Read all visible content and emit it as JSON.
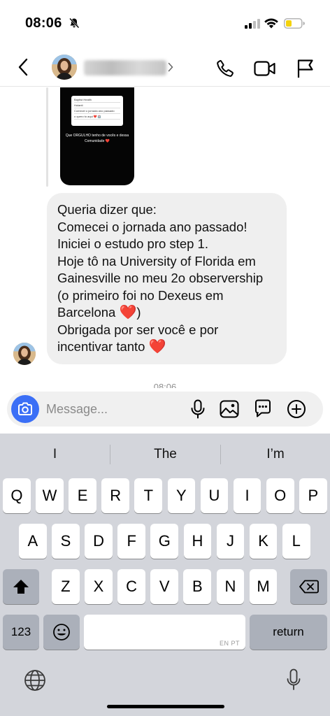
{
  "status": {
    "time": "08:06"
  },
  "story": {
    "card_lines": [
      "Baptist Health",
      "Holanti",
      "Comecei o jornada ano passado",
      "o quero to aqui ❤️ 🏥"
    ],
    "caption": "Que ORGULHO tenho de vocês e dessa Comunidade ❤️"
  },
  "message": {
    "lines": [
      "Queria dizer que:",
      "Comecei o jornada ano passado!",
      "Iniciei o estudo pro step 1.",
      "Hoje tô na University of Florida em",
      "Gainesville no meu 2o observership",
      "(o primeiro foi no Dexeus em",
      "Barcelona",
      "Obrigada por ser você e por",
      "incentivar tanto"
    ],
    "emoji": "❤️",
    "timestamp": "08:06"
  },
  "composer": {
    "placeholder": "Message..."
  },
  "keyboard": {
    "suggestions": [
      "I",
      "The",
      "I’m"
    ],
    "rows": [
      [
        "Q",
        "W",
        "E",
        "R",
        "T",
        "Y",
        "U",
        "I",
        "O",
        "P"
      ],
      [
        "A",
        "S",
        "D",
        "F",
        "G",
        "H",
        "J",
        "K",
        "L"
      ],
      [
        "Z",
        "X",
        "C",
        "V",
        "B",
        "N",
        "M"
      ]
    ],
    "numbers_label": "123",
    "return_label": "return",
    "lang_hint": "EN PT"
  },
  "colors": {
    "accent_blue": "#3b6ff6",
    "bubble_bg": "#efefef",
    "keyboard_bg": "#d3d5db",
    "heart_red": "#e8202a",
    "battery_yellow": "#f4d20c"
  },
  "icons": [
    "bell-off-icon",
    "cellular-signal-icon",
    "wifi-icon",
    "battery-low-power-icon",
    "back-chevron-icon",
    "phone-call-icon",
    "video-call-icon",
    "flag-report-icon",
    "camera-icon",
    "microphone-icon",
    "gallery-image-icon",
    "sticker-chat-icon",
    "add-plus-icon",
    "shift-icon",
    "backspace-icon",
    "emoji-icon",
    "globe-icon",
    "dictation-mic-icon"
  ]
}
